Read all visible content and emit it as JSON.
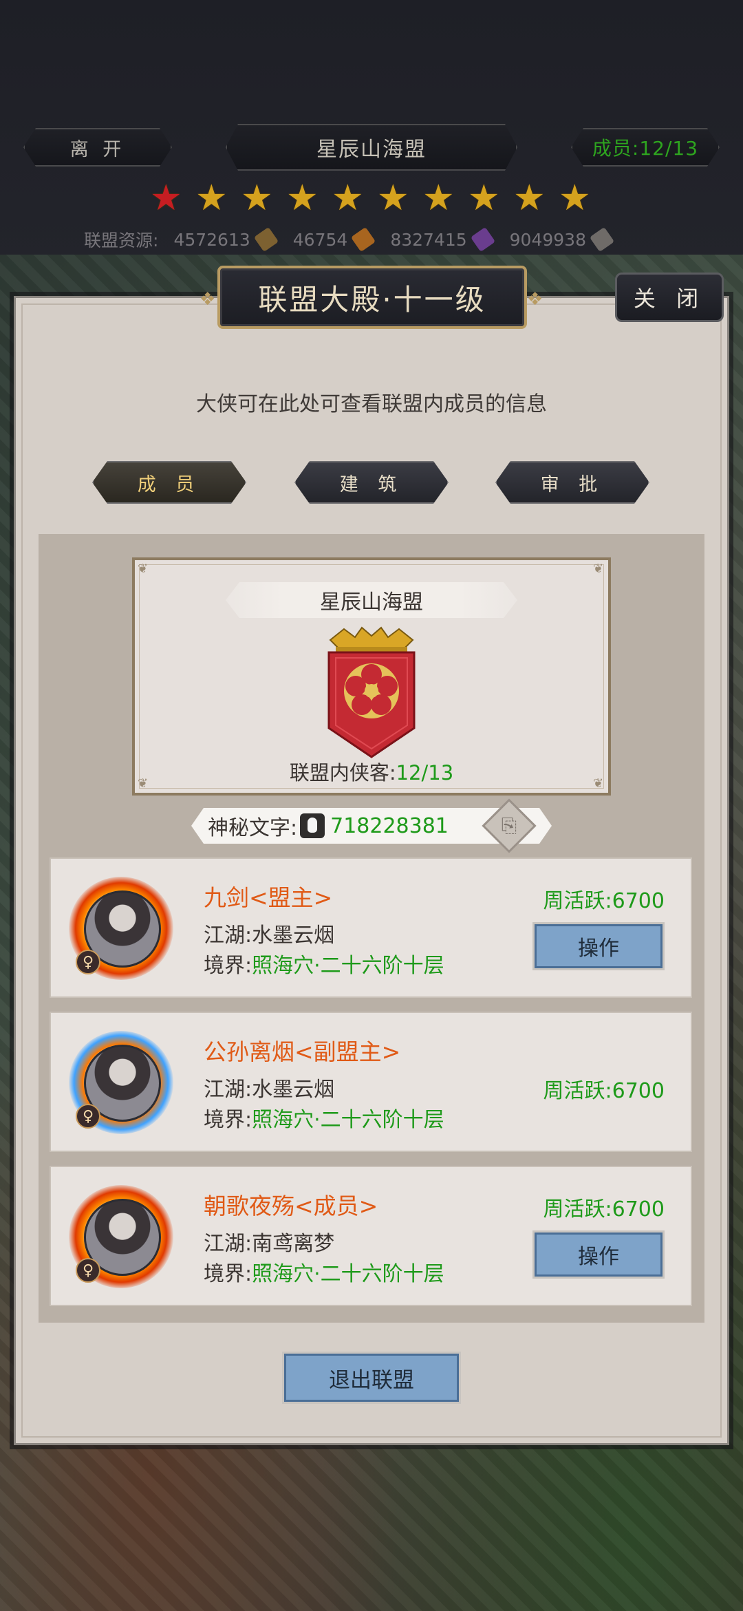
{
  "header": {
    "leave_label": "离 开",
    "alliance_title": "星辰山海盟",
    "members_label": "成员:12/13",
    "stars_total": 10,
    "stars_red": 1,
    "resources_label": "联盟资源:",
    "resources": [
      {
        "value": "4572613",
        "icon": "scroll-icon",
        "color": "#7d6131"
      },
      {
        "value": "46754",
        "icon": "token-icon",
        "color": "#a8651f"
      },
      {
        "value": "8327415",
        "icon": "crystal-icon",
        "color": "#6a3d8e"
      },
      {
        "value": "9049938",
        "icon": "ingot-icon",
        "color": "#6f6b68"
      }
    ]
  },
  "panel": {
    "title": "联盟大殿·十一级",
    "close_label": "关 闭",
    "description": "大侠可在此处可查看联盟内成员的信息",
    "tabs": [
      {
        "label": "成 员",
        "active": true
      },
      {
        "label": "建 筑",
        "active": false
      },
      {
        "label": "审 批",
        "active": false
      }
    ]
  },
  "info": {
    "alliance_name": "星辰山海盟",
    "count_label": "联盟内侠客:",
    "count_value": "12/13",
    "secret_label": "神秘文字:",
    "secret_value": "718228381"
  },
  "members": [
    {
      "name": "九剑<盟主>",
      "jianghu_label": "江湖:",
      "jianghu": "水墨云烟",
      "realm_label": "境界:",
      "realm": "照海穴·二十六阶十层",
      "active": "周活跃:6700",
      "op_label": "操作",
      "gender": "♀"
    },
    {
      "name": "公孙离烟<副盟主>",
      "jianghu_label": "江湖:",
      "jianghu": "水墨云烟",
      "realm_label": "境界:",
      "realm": "照海穴·二十六阶十层",
      "active": "周活跃:6700",
      "op_label": "",
      "gender": "♀"
    },
    {
      "name": "朝歌夜殇<成员>",
      "jianghu_label": "江湖:",
      "jianghu": "南鸢离梦",
      "realm_label": "境界:",
      "realm": "照海穴·二十六阶十层",
      "active": "周活跃:6700",
      "op_label": "操作",
      "gender": "♀"
    }
  ],
  "quit_label": "退出联盟",
  "colors": {
    "accent_green": "#1e9a1a",
    "name_orange": "#e05a16",
    "button_blue": "#7ea3c9"
  }
}
